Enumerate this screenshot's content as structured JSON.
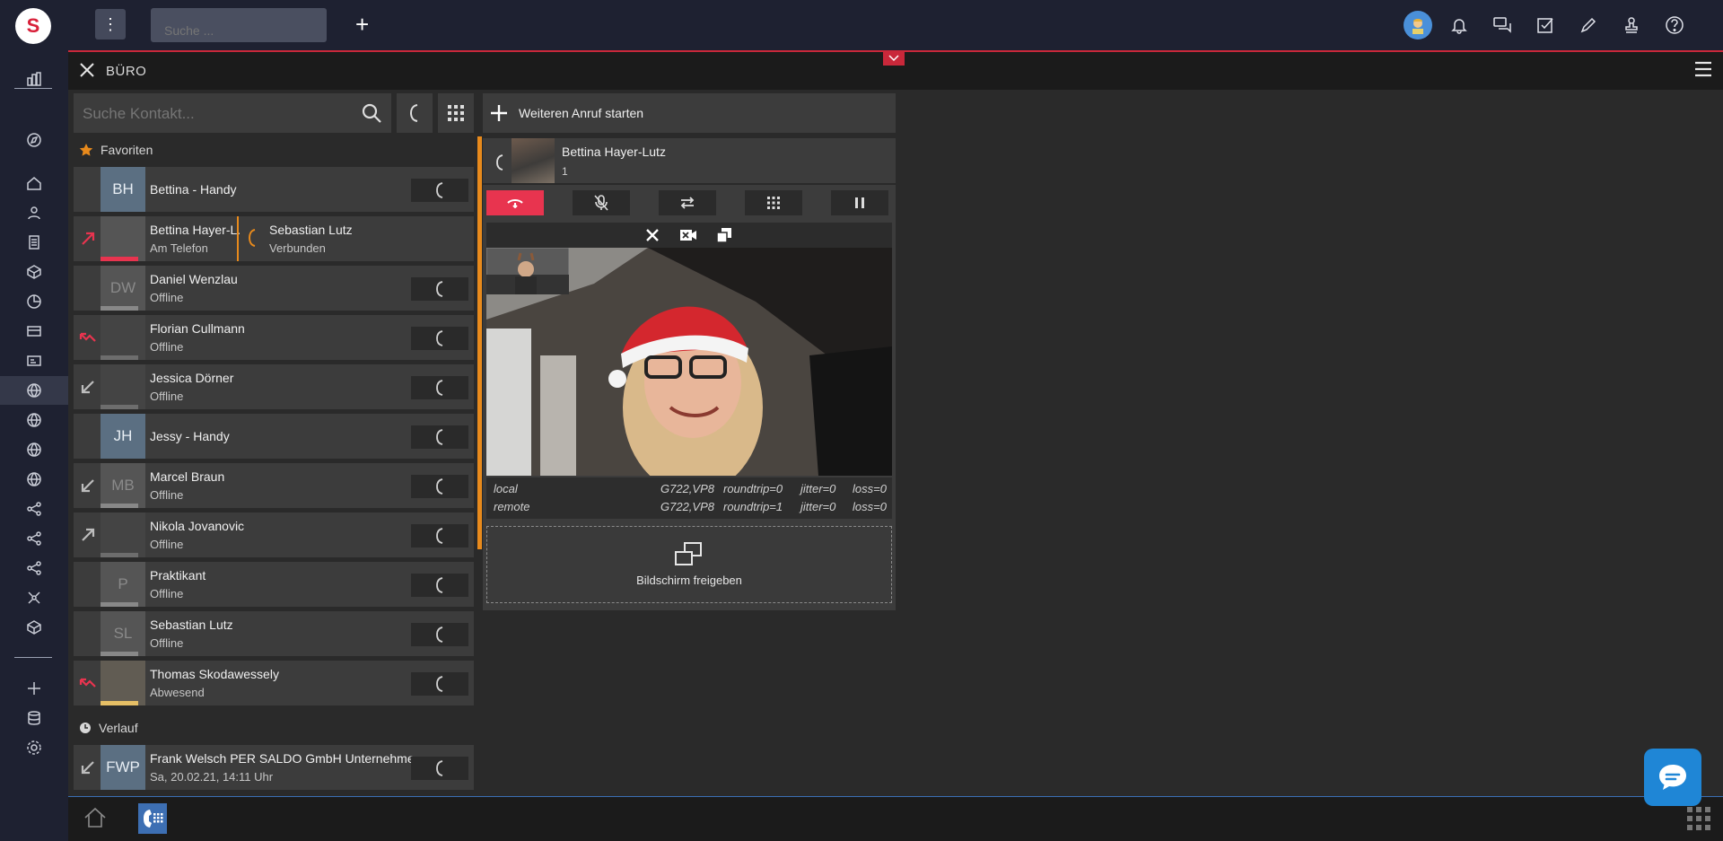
{
  "app": {
    "logo_letter": "S"
  },
  "topbar": {
    "search_placeholder": "Suche ...",
    "plus": "+"
  },
  "module": {
    "title": "BÜRO"
  },
  "contacts": {
    "search_placeholder": "Suche Kontakt...",
    "favorites_label": "Favoriten",
    "history_label": "Verlauf",
    "favorites": [
      {
        "initials": "BH",
        "name": "Bettina - Handy",
        "status": ""
      },
      {
        "initials": "",
        "name": "Bettina Hayer-L...",
        "status": "Am Telefon",
        "linked_name": "Sebastian Lutz",
        "linked_status": "Verbunden"
      },
      {
        "initials": "DW",
        "name": "Daniel Wenzlau",
        "status": "Offline"
      },
      {
        "initials": "",
        "name": "Florian Cullmann",
        "status": "Offline"
      },
      {
        "initials": "",
        "name": "Jessica Dörner",
        "status": "Offline"
      },
      {
        "initials": "JH",
        "name": "Jessy - Handy",
        "status": ""
      },
      {
        "initials": "MB",
        "name": "Marcel Braun",
        "status": "Offline"
      },
      {
        "initials": "",
        "name": "Nikola Jovanovic",
        "status": "Offline"
      },
      {
        "initials": "P",
        "name": "Praktikant",
        "status": "Offline"
      },
      {
        "initials": "SL",
        "name": "Sebastian Lutz",
        "status": "Offline"
      },
      {
        "initials": "",
        "name": "Thomas Skodawessely",
        "status": "Abwesend"
      }
    ],
    "history": [
      {
        "initials": "FWP",
        "name": "Frank Welsch PER SALDO GmbH Unternehme...",
        "status": "Sa, 20.02.21, 14:11 Uhr"
      }
    ]
  },
  "call": {
    "new_call_label": "Weiteren Anruf starten",
    "contact_name": "Bettina Hayer-Lutz",
    "contact_number": "1",
    "stats": [
      {
        "dir": "local",
        "codec": "G722,VP8",
        "roundtrip": "roundtrip=0",
        "jitter": "jitter=0",
        "loss": "loss=0"
      },
      {
        "dir": "remote",
        "codec": "G722,VP8",
        "roundtrip": "roundtrip=1",
        "jitter": "jitter=0",
        "loss": "loss=0"
      }
    ],
    "share_label": "Bildschirm freigeben"
  },
  "colors": {
    "accent_red": "#c9283a",
    "hangup": "#e8344f",
    "orange": "#e88a1c",
    "blue": "#3d6fb3",
    "chat": "#1f86d6"
  }
}
